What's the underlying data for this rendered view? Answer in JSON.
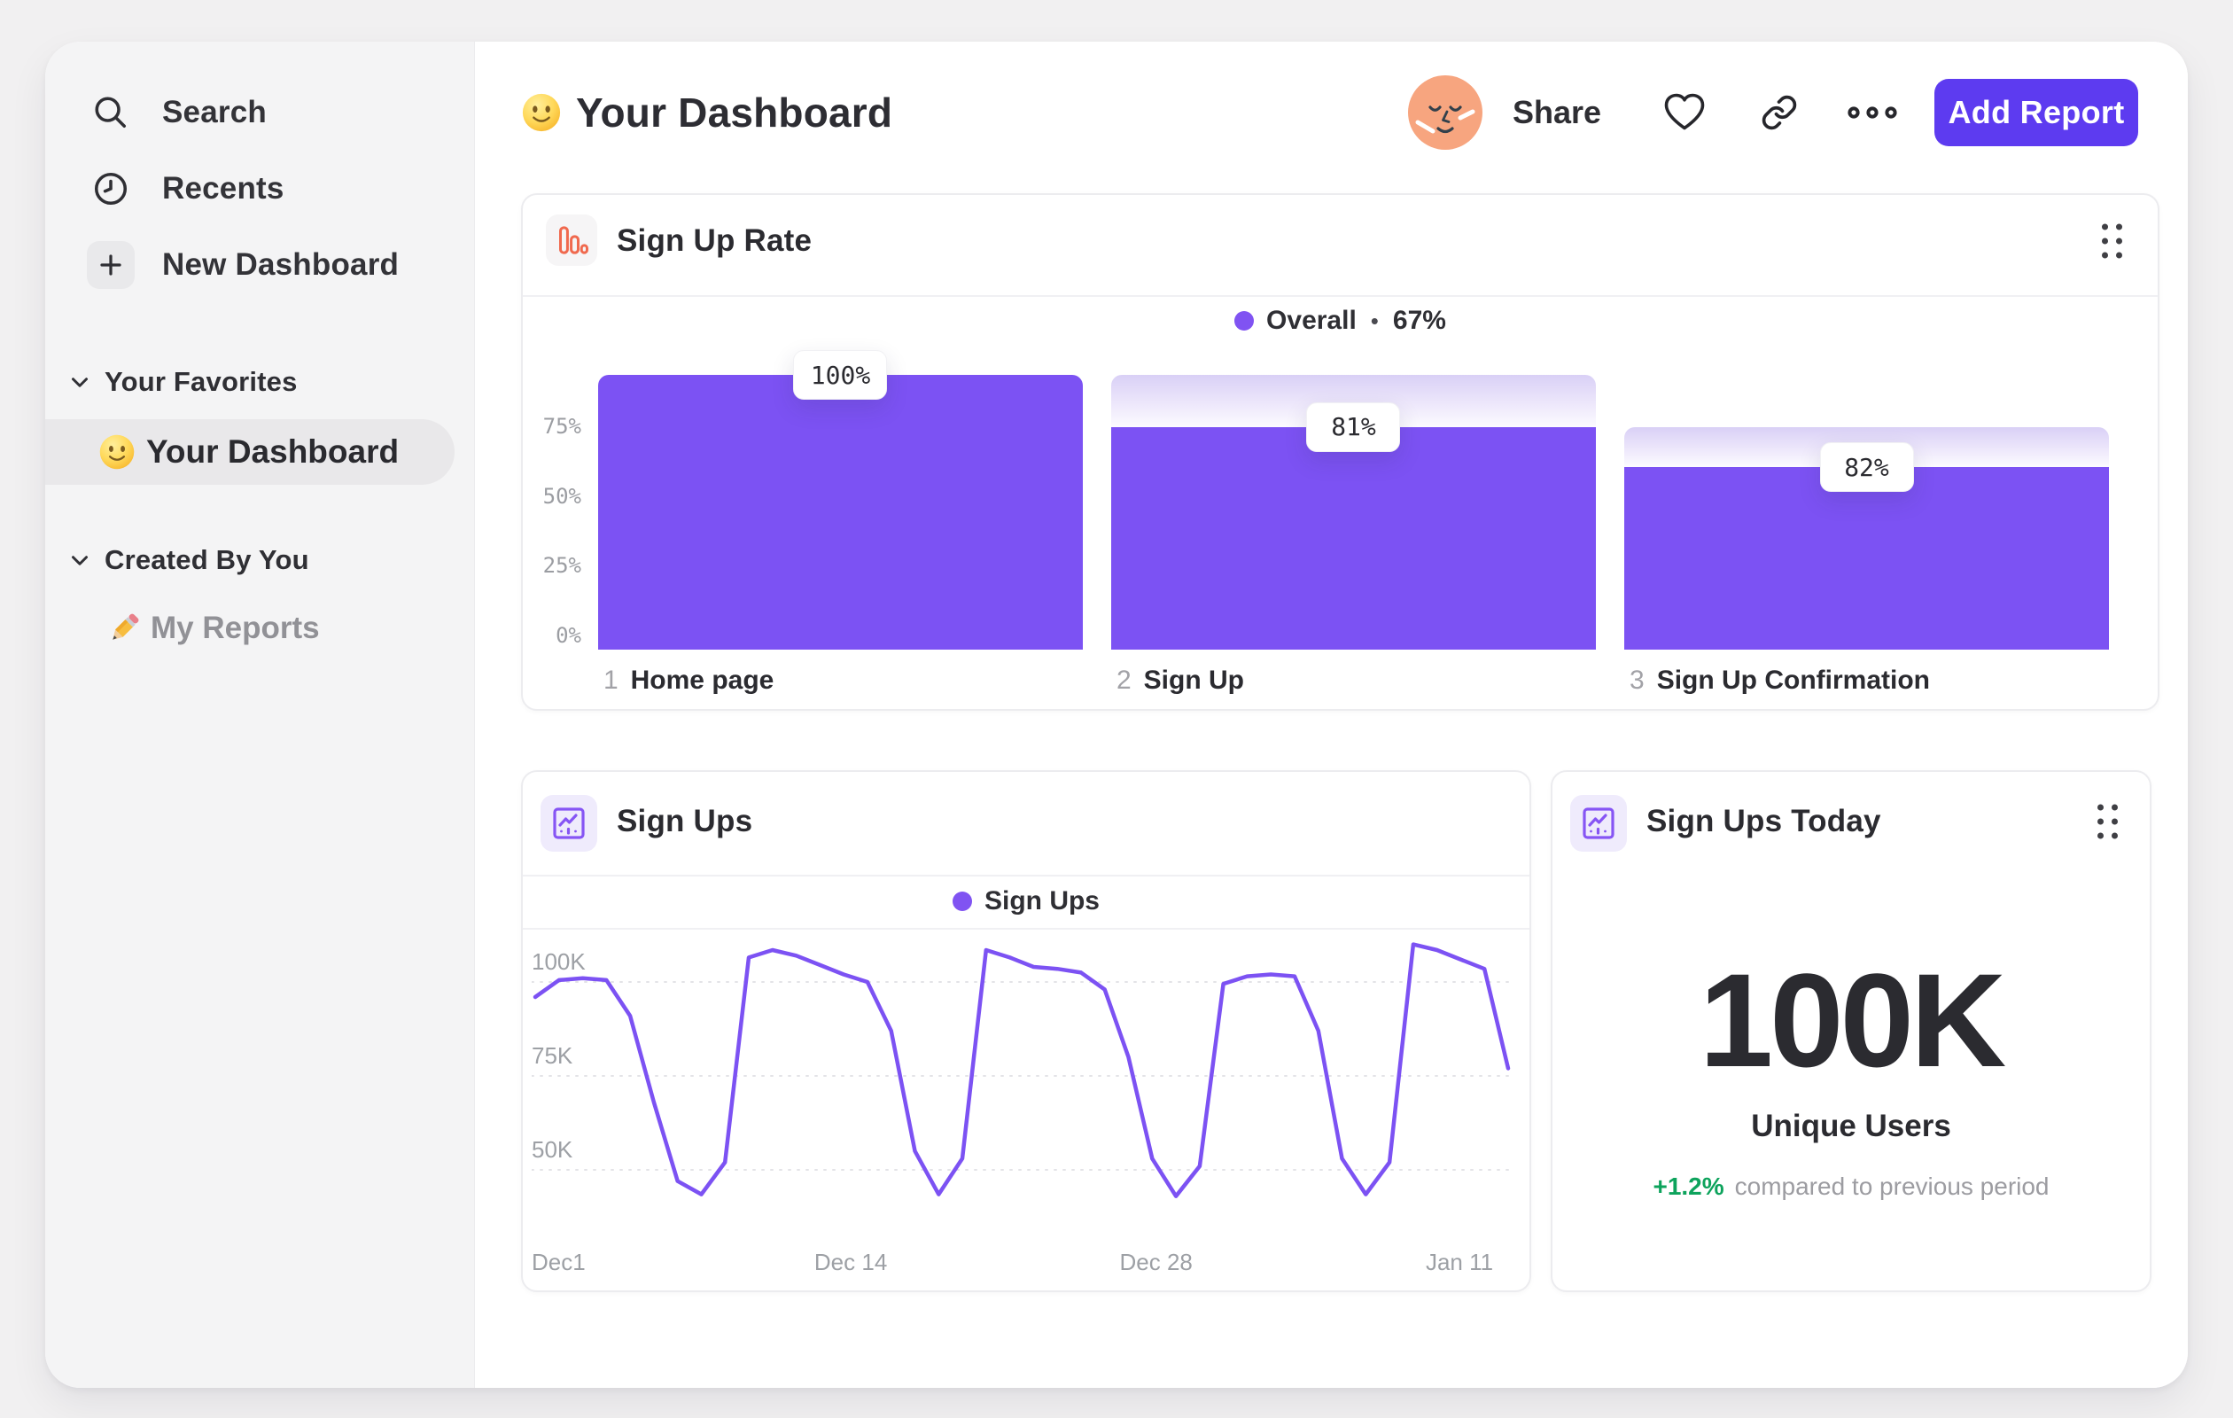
{
  "sidebar": {
    "nav": [
      {
        "label": "Search",
        "icon": "search"
      },
      {
        "label": "Recents",
        "icon": "clock"
      },
      {
        "label": "New Dashboard",
        "icon": "plus"
      }
    ],
    "sections": [
      {
        "label": "Your Favorites"
      },
      {
        "label": "Created By You"
      }
    ],
    "favorites_item": {
      "label": "Your Dashboard",
      "icon": "smiley-emoji",
      "selected": true
    },
    "created_item": {
      "label": "My Reports",
      "icon": "pencil-emoji"
    }
  },
  "header": {
    "title": "Your Dashboard",
    "share": "Share",
    "add_report": "Add Report"
  },
  "funnel_card": {
    "title": "Sign Up Rate",
    "legend_name": "Overall",
    "legend_sep": "•",
    "legend_value": "67%"
  },
  "line_card": {
    "title": "Sign Ups",
    "legend_name": "Sign Ups"
  },
  "stat_card": {
    "title": "Sign Ups Today",
    "value": "100K",
    "label": "Unique Users",
    "change": "+1.2%",
    "change_desc": "compared to previous period"
  },
  "colors": {
    "purple": "#7C52F3",
    "legend_dot": "#8053F2",
    "button": "#5D3BF0",
    "green": "#0DA35C",
    "orange_icon": "#F0694E",
    "grid": "#E3E3E7"
  },
  "chart_data": [
    {
      "id": "sign-up-rate-funnel",
      "type": "bar",
      "subtype": "funnel",
      "title": "Sign Up Rate",
      "legend": {
        "series": "Overall",
        "overall_conversion": "67%"
      },
      "ylim": [
        0,
        100
      ],
      "yticks": [
        {
          "label": "75%",
          "value": 75
        },
        {
          "label": "50%",
          "value": 50
        },
        {
          "label": "25%",
          "value": 25
        },
        {
          "label": "0%",
          "value": 0
        }
      ],
      "bar_color": "#7C52F3",
      "steps": [
        {
          "index": "1",
          "name": "Home page",
          "label": "100%",
          "step_conversion_pct": 100,
          "overall_pct": 100,
          "prev_overall_pct": 100
        },
        {
          "index": "2",
          "name": "Sign Up",
          "label": "81%",
          "step_conversion_pct": 81,
          "overall_pct": 81,
          "prev_overall_pct": 100
        },
        {
          "index": "3",
          "name": "Sign Up Confirmation",
          "label": "82%",
          "step_conversion_pct": 82,
          "overall_pct": 66.4,
          "prev_overall_pct": 81
        }
      ]
    },
    {
      "id": "sign-ups-line",
      "type": "line",
      "title": "Sign Ups",
      "x_unit": "day",
      "x_range": [
        "Dec 1",
        "Jan 11"
      ],
      "xticks": [
        {
          "label": "Dec1",
          "frac": 0
        },
        {
          "label": "Dec 14",
          "frac": 0.325
        },
        {
          "label": "Dec 28",
          "frac": 0.636
        },
        {
          "label": "Jan 11",
          "frac": 0.945
        }
      ],
      "yticks": [
        {
          "label": "100K",
          "value": 100
        },
        {
          "label": "75K",
          "value": 75
        },
        {
          "label": "50K",
          "value": 50
        }
      ],
      "ylim": [
        30,
        114
      ],
      "grid": "dashed-horizontal",
      "series": [
        {
          "name": "Sign Ups",
          "color": "#7C52F3",
          "unit": "K",
          "values": [
            96,
            100.5,
            101,
            100.5,
            91,
            68,
            47,
            43.5,
            52,
            106.5,
            108.5,
            107,
            104.5,
            102,
            100,
            87,
            55,
            43.5,
            53,
            108.5,
            106.5,
            104,
            103.5,
            102.5,
            98,
            80,
            53,
            43,
            51,
            99.5,
            101.5,
            102,
            101.5,
            87,
            53,
            43.5,
            52,
            110,
            108.5,
            106,
            103.5,
            77
          ]
        }
      ]
    },
    {
      "id": "sign-ups-today-stat",
      "type": "stat",
      "title": "Sign Ups Today",
      "value": "100K",
      "metric": "Unique Users",
      "change": "+1.2%",
      "change_direction": "up",
      "comparison": "compared to previous period"
    }
  ]
}
